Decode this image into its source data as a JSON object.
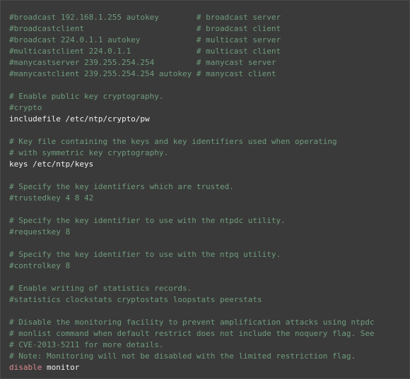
{
  "colors": {
    "background": "#3a3a3a",
    "comment": "#6f9c7c",
    "text": "#f0f0f0",
    "keyword": "#d98a8e"
  },
  "lines": [
    [
      {
        "t": "comment",
        "v": "#broadcast 192.168.1.255 autokey        # broadcast server"
      }
    ],
    [
      {
        "t": "comment",
        "v": "#broadcastclient                        # broadcast client"
      }
    ],
    [
      {
        "t": "comment",
        "v": "#broadcast 224.0.1.1 autokey            # multicast server"
      }
    ],
    [
      {
        "t": "comment",
        "v": "#multicastclient 224.0.1.1              # multicast client"
      }
    ],
    [
      {
        "t": "comment",
        "v": "#manycastserver 239.255.254.254         # manycast server"
      }
    ],
    [
      {
        "t": "comment",
        "v": "#manycastclient 239.255.254.254 autokey # manycast client"
      }
    ],
    [],
    [
      {
        "t": "comment",
        "v": "# Enable public key cryptography."
      }
    ],
    [
      {
        "t": "comment",
        "v": "#crypto"
      }
    ],
    [
      {
        "t": "plain",
        "v": "includefile /etc/ntp/crypto/pw"
      }
    ],
    [],
    [
      {
        "t": "comment",
        "v": "# Key file containing the keys and key identifiers used when operating"
      }
    ],
    [
      {
        "t": "comment",
        "v": "# with symmetric key cryptography."
      }
    ],
    [
      {
        "t": "plain",
        "v": "keys /etc/ntp/keys"
      }
    ],
    [],
    [
      {
        "t": "comment",
        "v": "# Specify the key identifiers which are trusted."
      }
    ],
    [
      {
        "t": "comment",
        "v": "#trustedkey 4 8 42"
      }
    ],
    [],
    [
      {
        "t": "comment",
        "v": "# Specify the key identifier to use with the ntpdc utility."
      }
    ],
    [
      {
        "t": "comment",
        "v": "#requestkey 8"
      }
    ],
    [],
    [
      {
        "t": "comment",
        "v": "# Specify the key identifier to use with the ntpq utility."
      }
    ],
    [
      {
        "t": "comment",
        "v": "#controlkey 8"
      }
    ],
    [],
    [
      {
        "t": "comment",
        "v": "# Enable writing of statistics records."
      }
    ],
    [
      {
        "t": "comment",
        "v": "#statistics clockstats cryptostats loopstats peerstats"
      }
    ],
    [],
    [
      {
        "t": "comment",
        "v": "# Disable the monitoring facility to prevent amplification attacks using ntpdc"
      }
    ],
    [
      {
        "t": "comment",
        "v": "# monlist command when default restrict does not include the noquery flag. See"
      }
    ],
    [
      {
        "t": "comment",
        "v": "# CVE-2013-5211 for more details."
      }
    ],
    [
      {
        "t": "comment",
        "v": "# Note: Monitoring will not be disabled with the limited restriction flag."
      }
    ],
    [
      {
        "t": "keyword",
        "v": "disable"
      },
      {
        "t": "plain",
        "v": " monitor"
      }
    ]
  ]
}
